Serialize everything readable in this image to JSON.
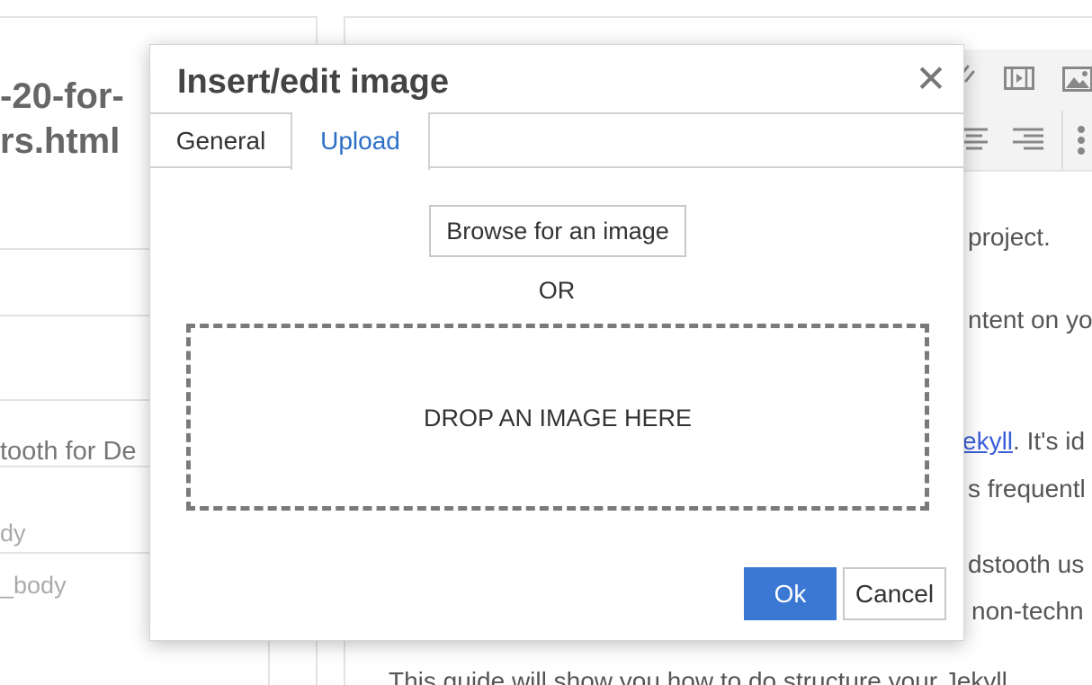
{
  "background": {
    "left_panel": {
      "slug_line1": "-20-for-",
      "slug_line2": "rs.html",
      "doc_title": "tooth for De",
      "field1": "dy",
      "field2": "_body"
    },
    "editor": {
      "line1": "project.",
      "line2": "ntent on yo",
      "line3_link": "ekyll",
      "line3_rest": ". It's id",
      "line4": "s frequentl",
      "line5": "dstooth us",
      "line6": "non-techn",
      "line7": "This guide will show you how to do structure your Jekyll"
    }
  },
  "modal": {
    "title": "Insert/edit image",
    "close_symbol": "✕",
    "tabs": [
      {
        "label": "General",
        "active": false
      },
      {
        "label": "Upload",
        "active": true
      }
    ],
    "browse_label": "Browse for an image",
    "or_label": "OR",
    "dropzone_label": "DROP AN IMAGE HERE",
    "ok_label": "Ok",
    "cancel_label": "Cancel"
  },
  "colors": {
    "primary": "#3a78d4",
    "active_tab": "#2d6fc7",
    "link": "#3a5fd9"
  },
  "icons": [
    "link-icon",
    "media-icon",
    "image-icon",
    "align-center-icon",
    "align-right-icon",
    "bullet-list-icon"
  ]
}
